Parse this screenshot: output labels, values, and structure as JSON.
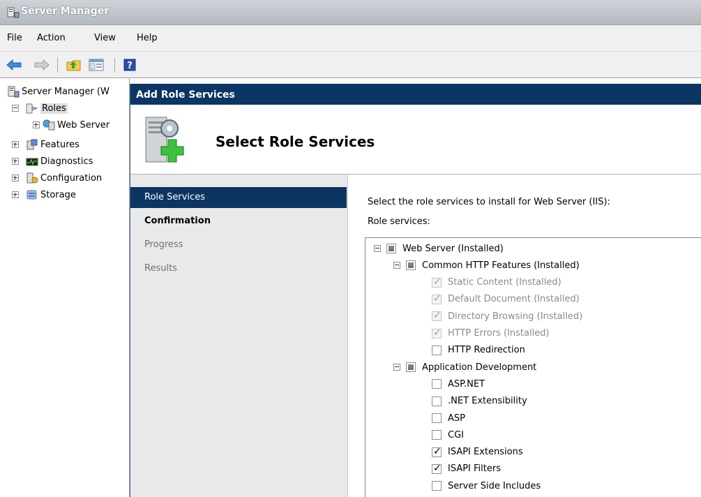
{
  "window": {
    "title": "Server Manager"
  },
  "menu": [
    "File",
    "Action",
    "View",
    "Help"
  ],
  "tree": {
    "items": [
      {
        "label": "Server Manager (W",
        "expander": "none",
        "icon": "server-icon"
      },
      {
        "label": "Roles",
        "expander": "minus",
        "icon": "roles-icon",
        "selected": true
      },
      {
        "label": "Web Server",
        "expander": "plus",
        "icon": "web-server-icon"
      },
      {
        "label": "Features",
        "expander": "plus",
        "icon": "features-icon"
      },
      {
        "label": "Diagnostics",
        "expander": "plus",
        "icon": "diagnostics-icon"
      },
      {
        "label": "Configuration",
        "expander": "plus",
        "icon": "configuration-icon"
      },
      {
        "label": "Storage",
        "expander": "plus",
        "icon": "storage-icon"
      }
    ]
  },
  "dialog": {
    "title": "Add Role Services",
    "heading": "Select Role Services",
    "steps": [
      {
        "label": "Role Services",
        "state": "active"
      },
      {
        "label": "Confirmation",
        "state": "next"
      },
      {
        "label": "Progress",
        "state": "pending"
      },
      {
        "label": "Results",
        "state": "pending"
      }
    ],
    "instruction": "Select the role services to install for Web Server (IIS):",
    "role_services_label": "Role services:",
    "services": [
      {
        "label": "Web Server  (Installed)",
        "level": 0,
        "expander": "minus",
        "state": "partial",
        "disabled": false
      },
      {
        "label": "Common HTTP Features  (Installed)",
        "level": 1,
        "expander": "minus",
        "state": "partial",
        "disabled": false
      },
      {
        "label": "Static Content  (Installed)",
        "level": 2,
        "state": "checked",
        "disabled": true
      },
      {
        "label": "Default Document  (Installed)",
        "level": 2,
        "state": "checked",
        "disabled": true
      },
      {
        "label": "Directory Browsing  (Installed)",
        "level": 2,
        "state": "checked",
        "disabled": true
      },
      {
        "label": "HTTP Errors  (Installed)",
        "level": 2,
        "state": "checked",
        "disabled": true
      },
      {
        "label": "HTTP Redirection",
        "level": 2,
        "state": "unchecked",
        "disabled": false
      },
      {
        "label": "Application Development",
        "level": 1,
        "expander": "minus",
        "state": "partial",
        "disabled": false
      },
      {
        "label": "ASP.NET",
        "level": 2,
        "state": "unchecked",
        "disabled": false
      },
      {
        "label": ".NET Extensibility",
        "level": 2,
        "state": "unchecked",
        "disabled": false
      },
      {
        "label": "ASP",
        "level": 2,
        "state": "unchecked",
        "disabled": false
      },
      {
        "label": "CGI",
        "level": 2,
        "state": "unchecked",
        "disabled": false
      },
      {
        "label": "ISAPI Extensions",
        "level": 2,
        "state": "checked",
        "disabled": false
      },
      {
        "label": "ISAPI Filters",
        "level": 2,
        "state": "checked",
        "disabled": false
      },
      {
        "label": "Server Side Includes",
        "level": 2,
        "state": "unchecked",
        "disabled": false
      }
    ]
  },
  "colors": {
    "dialog_title_bg": "#0b3563",
    "active_step_bg": "#0b3563",
    "nav_bg": "#e9e9e9"
  }
}
